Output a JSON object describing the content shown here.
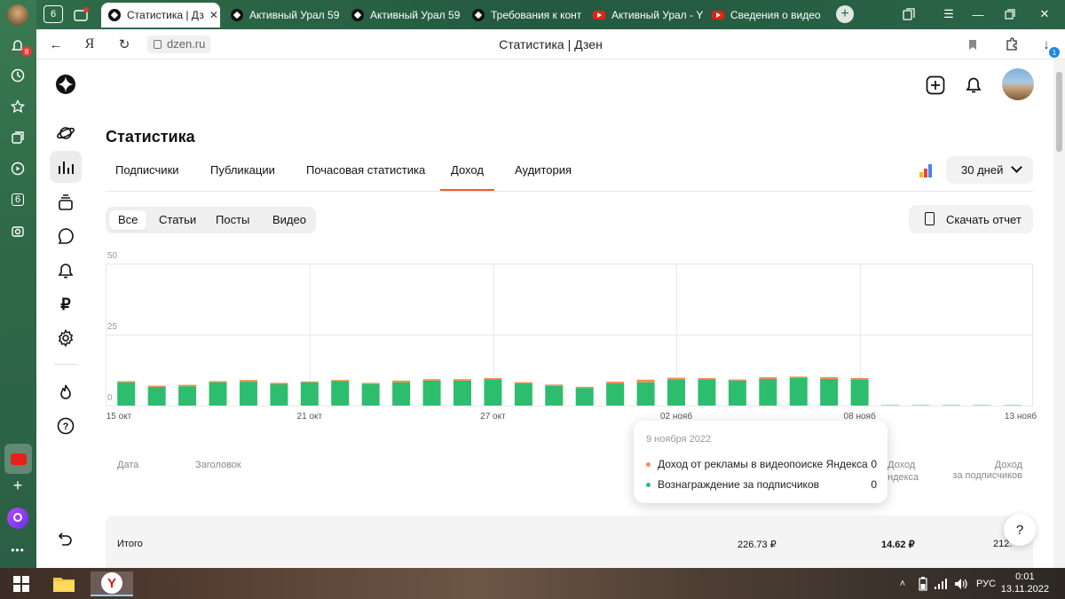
{
  "browser": {
    "tabs": [
      {
        "label": "Статистика | Дз",
        "active": true
      },
      {
        "label": "Активный Урал 59",
        "icon": "dzen"
      },
      {
        "label": "Активный Урал 59",
        "icon": "dzen"
      },
      {
        "label": "Требования к конт",
        "icon": "dzen"
      },
      {
        "label": "Активный Урал - Y",
        "icon": "youtube"
      },
      {
        "label": "Сведения о видео",
        "icon": "youtube"
      }
    ],
    "tab_counter": "6",
    "url": "dzen.ru",
    "page_title": "Статистика | Дзен",
    "notif_badge": "8",
    "downloads_badge": "1",
    "side_counter": "6"
  },
  "page": {
    "title": "Статистика",
    "tabs": [
      "Подписчики",
      "Публикации",
      "Почасовая статистика",
      "Доход",
      "Аудитория"
    ],
    "active_tab": "Доход",
    "period": "30 дней",
    "filters": [
      "Все",
      "Статьи",
      "Посты",
      "Видео"
    ],
    "active_filter": "Все",
    "download_label": "Скачать отчет"
  },
  "chart_data": {
    "type": "bar",
    "stacked": true,
    "ylim": [
      0,
      50
    ],
    "yticks": [
      "50",
      "25",
      "0"
    ],
    "xticks": [
      "15 окт",
      "21 окт",
      "27 окт",
      "02 нояб",
      "08 нояб",
      "13 нояб"
    ],
    "colors": {
      "main": "#2dbd6e",
      "top": "#ff8a4c",
      "empty": "#9ee0c0"
    },
    "series": [
      {
        "name": "Вознаграждение за подписчиков",
        "values": [
          8.2,
          6.6,
          6.8,
          8.2,
          8.4,
          7.5,
          8.2,
          8.6,
          7.6,
          8.2,
          8.8,
          8.8,
          9.2,
          7.8,
          6.9,
          6.2,
          7.8,
          8.2,
          9.2,
          9.2,
          8.8,
          9.4,
          9.8,
          9.4,
          9.2,
          0.3,
          0.3,
          0.3,
          0.3,
          0.3
        ]
      },
      {
        "name": "Доход от рекламы в видеопоиске Яндекса",
        "values": [
          0.4,
          0.4,
          0.5,
          0.4,
          0.6,
          0.5,
          0.3,
          0.4,
          0.4,
          0.6,
          0.5,
          0.5,
          0.5,
          0.4,
          0.5,
          0.4,
          0.6,
          0.9,
          0.6,
          0.5,
          0.4,
          0.6,
          0.4,
          0.6,
          0.5,
          0,
          0,
          0,
          0,
          0
        ]
      }
    ]
  },
  "tooltip": {
    "date": "9 ноября 2022",
    "rows": [
      {
        "label": "Доход от рекламы в видеопоиске Яндекса",
        "value": "0",
        "color": "#ff8a4c"
      },
      {
        "label": "Вознаграждение за подписчиков",
        "value": "0",
        "color": "#2dbd6e"
      }
    ]
  },
  "table": {
    "headers": {
      "date": "Дата",
      "title": "Заголовок",
      "col_ad_1": "Доход",
      "col_ad_2": "ндекса",
      "col_sub_1": "Доход",
      "col_sub_2": "за подписчиков"
    },
    "total": {
      "label": "Итого",
      "value1": "226.73 ₽",
      "value2": "14.62 ₽",
      "value3": "212."
    }
  },
  "taskbar": {
    "language": "РУС",
    "time": "0:01",
    "date": "13.11.2022"
  }
}
